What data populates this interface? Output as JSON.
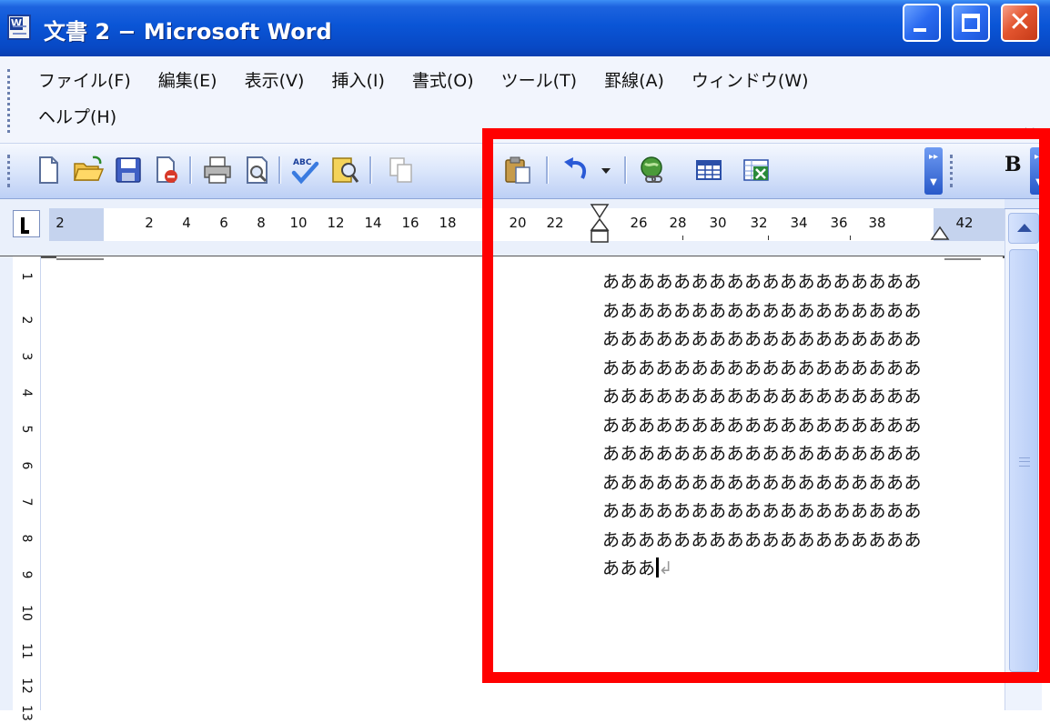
{
  "window": {
    "title": "文書 2 − Microsoft Word",
    "app_icon": "word-document-icon",
    "title_bar_color": "#0a55d6",
    "close_button_color": "#e3552f"
  },
  "menubar": {
    "items": [
      "ファイル(F)",
      "編集(E)",
      "表示(V)",
      "挿入(I)",
      "書式(O)",
      "ツール(T)",
      "罫線(A)",
      "ウィンドウ(W)"
    ],
    "second_row_item": "ヘルプ(H)",
    "close_document": "×"
  },
  "toolbar": {
    "icons": [
      "new-document-icon",
      "open-folder-icon",
      "save-icon",
      "permission-icon",
      "print-icon",
      "print-preview-icon",
      "spelling-check-icon",
      "research-icon",
      "copy-icon",
      "paste-icon",
      "undo-icon",
      "undo-dropdown-icon",
      "hyperlink-icon",
      "insert-table-icon",
      "insert-excel-icon"
    ],
    "bold_label": "B"
  },
  "ruler": {
    "labels": [
      "2",
      "2",
      "4",
      "6",
      "8",
      "10",
      "12",
      "14",
      "16",
      "18",
      "20",
      "22",
      "26",
      "28",
      "30",
      "32",
      "34",
      "36",
      "38",
      "42"
    ],
    "vertical_labels": [
      "1",
      "2",
      "3",
      "4",
      "5",
      "6",
      "7",
      "8",
      "9",
      "10",
      "11",
      "12",
      "13"
    ]
  },
  "document": {
    "lines": [
      "ああああああああああああああああああ",
      "ああああああああああああああああああ",
      "ああああああああああああああああああ",
      "ああああああああああああああああああ",
      "ああああああああああああああああああ",
      "ああああああああああああああああああ",
      "ああああああああああああああああああ",
      "ああああああああああああああああああ",
      "ああああああああああああああああああ",
      "ああああああああああああああああああ"
    ],
    "last_line": "あああ"
  },
  "highlight": {
    "color": "#ff0000"
  }
}
